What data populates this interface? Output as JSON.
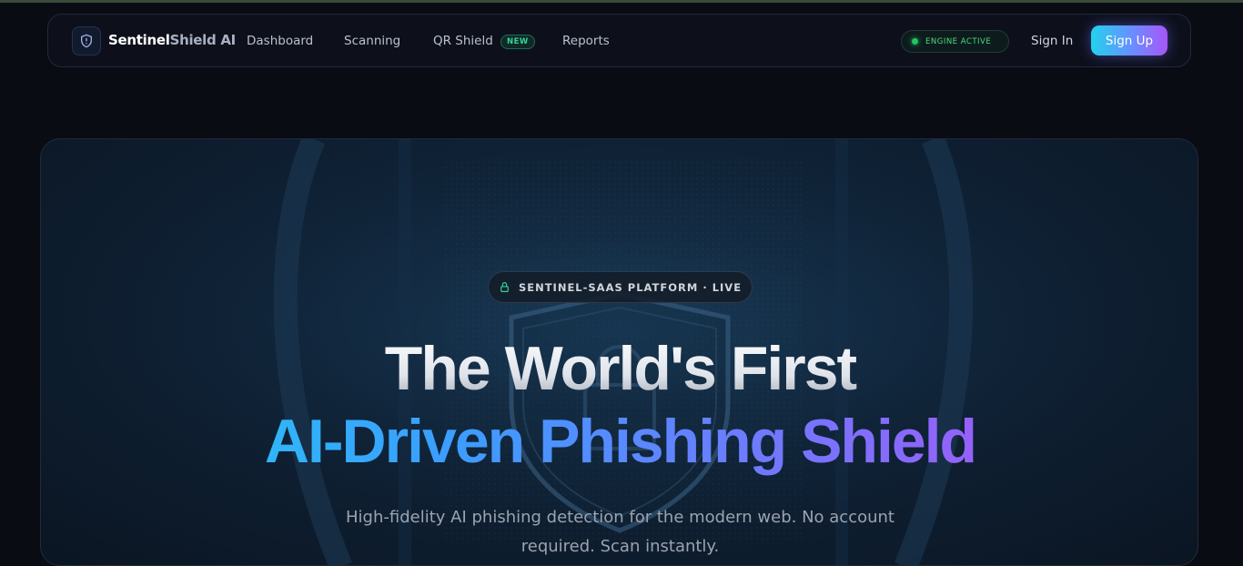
{
  "nav": {
    "brand_part1": "Sentinel",
    "brand_part2": "Shield AI",
    "links": [
      {
        "label": "Dashboard"
      },
      {
        "label": "Scanning"
      },
      {
        "label": "QR Shield",
        "badge": "NEW"
      },
      {
        "label": "Reports"
      }
    ],
    "engine_status": "ENGINE ACTIVE",
    "sign_in": "Sign In",
    "sign_up": "Sign Up"
  },
  "hero": {
    "badge_text": "SENTINEL-SAAS PLATFORM · LIVE",
    "headline_line1": "The World's First",
    "headline_line2": "AI-Driven Phishing Shield",
    "subtext": "High-fidelity AI phishing detection for the modern web. No account required. Scan instantly."
  },
  "icons": {
    "logo": "shield-icon",
    "badge": "lock-icon",
    "status": "status-dot-icon",
    "background": "shield-emblem-icon"
  },
  "colors": {
    "background": "#0a0c14",
    "accent_cyan": "#22d3ee",
    "accent_blue": "#3b9eff",
    "accent_purple": "#a855f7",
    "status_green": "#22c55e",
    "new_badge_green": "#34d399"
  }
}
